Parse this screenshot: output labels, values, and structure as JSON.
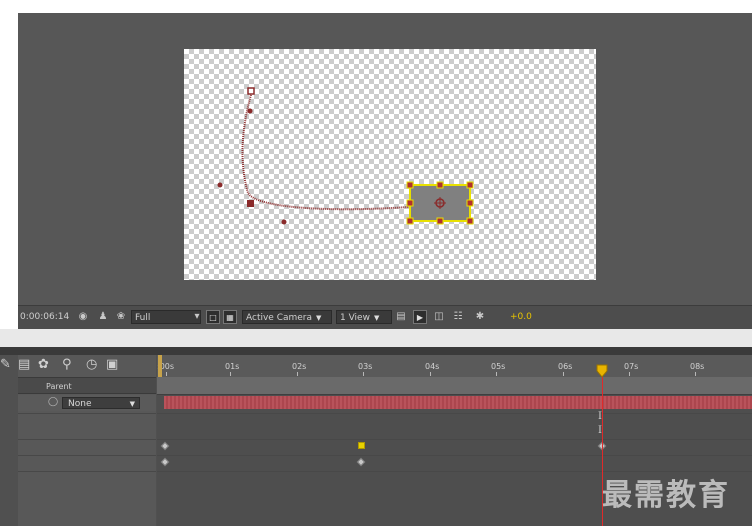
{
  "viewer_bar": {
    "timecode": "0:00:06:14",
    "resolution": "Full",
    "camera": "Active Camera",
    "view_layout": "1 View",
    "exposure": "+0.0"
  },
  "timeline": {
    "parent_header": "Parent",
    "parent_value": "None",
    "ruler_labels": [
      ":00s",
      "01s",
      "02s",
      "03s",
      "04s",
      "05s",
      "06s",
      "07s",
      "08s"
    ]
  },
  "watermark": "最需教育",
  "colors": {
    "layer_bar": "#b54a52",
    "cti": "#e02a2a",
    "selection": "#e8e000"
  },
  "icons": [
    "camera-snapshot-icon",
    "color-channels-icon",
    "transparency-grid-icon",
    "roi-icon",
    "3d-view-icon",
    "flowchart-icon",
    "fast-preview-icon",
    "pen-tool-icon",
    "shy-layers-icon",
    "stopwatch-icon"
  ]
}
